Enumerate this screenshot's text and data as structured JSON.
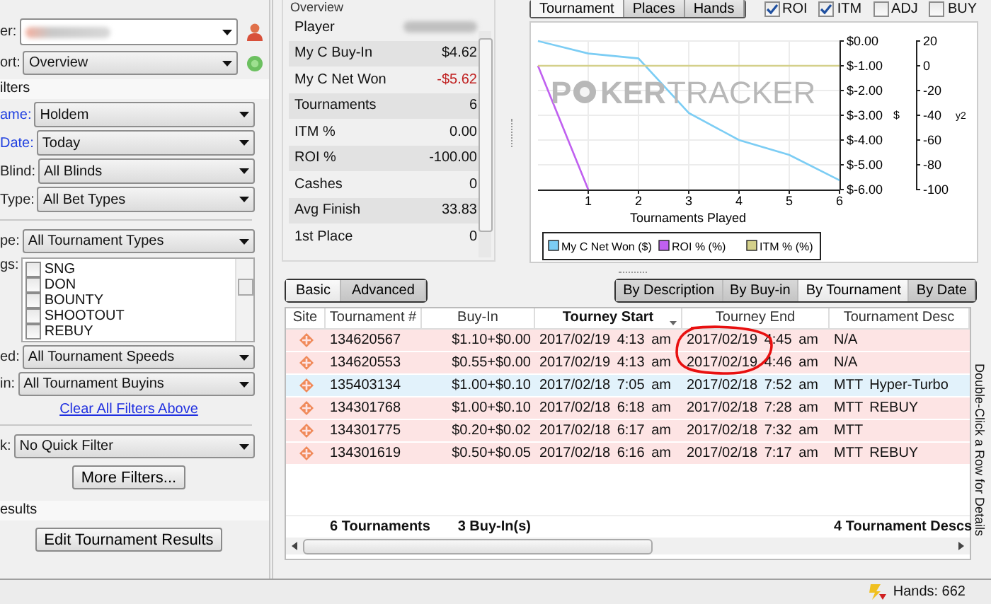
{
  "left_panel": {
    "player": {
      "label": "er:"
    },
    "report": {
      "label": "ort:",
      "value": "Overview"
    },
    "filters_title": "ilters",
    "filters": [
      {
        "label": "ame:",
        "value": "Holdem",
        "highlighted": true
      },
      {
        "label": "Date:",
        "value": "Today",
        "highlighted": true
      },
      {
        "label": "Blind:",
        "value": "All Blinds",
        "highlighted": false
      },
      {
        "label": "Type:",
        "value": "All Bet Types",
        "highlighted": false
      }
    ],
    "tournament_type": {
      "label": "pe:",
      "value": "All Tournament Types"
    },
    "flags": {
      "label": "gs:",
      "items": [
        {
          "label": "SNG",
          "checked": false
        },
        {
          "label": "DON",
          "checked": false
        },
        {
          "label": "BOUNTY",
          "checked": false
        },
        {
          "label": "SHOOTOUT",
          "checked": false
        },
        {
          "label": "REBUY",
          "checked": false
        }
      ]
    },
    "speed": {
      "label": "ed:",
      "value": "All Tournament Speeds"
    },
    "buyin": {
      "label": "in:",
      "value": "All Tournament Buyins"
    },
    "clear_link": "Clear All Filters Above",
    "quick_filter": {
      "label": "k:",
      "value": "No Quick Filter"
    },
    "more_filters_button": "More Filters...",
    "results_title": "esults",
    "edit_results_button": "Edit Tournament Results"
  },
  "overview": {
    "title": "Overview",
    "rows": [
      {
        "label": "Player",
        "value": "",
        "redacted": true,
        "negative": false
      },
      {
        "label": "My C Buy-In",
        "value": "$4.62",
        "redacted": false,
        "negative": false
      },
      {
        "label": "My C Net Won",
        "value": "-$5.62",
        "redacted": false,
        "negative": true
      },
      {
        "label": "Tournaments",
        "value": "6",
        "redacted": false,
        "negative": false
      },
      {
        "label": "ITM %",
        "value": "0.00",
        "redacted": false,
        "negative": false
      },
      {
        "label": "ROI %",
        "value": "-100.00",
        "redacted": false,
        "negative": false
      },
      {
        "label": "Cashes",
        "value": "0",
        "redacted": false,
        "negative": false
      },
      {
        "label": "Avg Finish",
        "value": "33.83",
        "redacted": false,
        "negative": false
      },
      {
        "label": "1st Place",
        "value": "0",
        "redacted": false,
        "negative": false
      }
    ]
  },
  "graph": {
    "tabs": [
      {
        "label": "Tournament",
        "selected": true
      },
      {
        "label": "Places",
        "selected": false
      },
      {
        "label": "Hands",
        "selected": false
      }
    ],
    "toggles": [
      {
        "label": "ROI",
        "checked": true
      },
      {
        "label": "ITM",
        "checked": true
      },
      {
        "label": "ADJ",
        "checked": false
      },
      {
        "label": "BUY",
        "checked": false
      }
    ],
    "watermark": {
      "lead": "P",
      "bold": "KER",
      "light": "TRACKER"
    },
    "chart_data": {
      "type": "line",
      "xlabel": "Tournaments Played",
      "ylabel": "$",
      "y2label": "y2",
      "x": [
        0,
        1,
        2,
        3,
        4,
        5,
        6
      ],
      "series": [
        {
          "name": "My C Net Won ($)",
          "color": "#7ccdf4",
          "axis": "y",
          "values": [
            0,
            -0.5,
            -0.7,
            -2.9,
            -4.0,
            -4.6,
            -5.62
          ]
        },
        {
          "name": "ROI % (%)",
          "color": "#c060f0",
          "axis": "y2",
          "values": [
            0,
            -100,
            null,
            null,
            null,
            null,
            null
          ]
        },
        {
          "name": "ITM % (%)",
          "color": "#d4d08a",
          "axis": "y2",
          "values": [
            0,
            0,
            0,
            0,
            0,
            0,
            0
          ]
        }
      ],
      "grid": true,
      "legend": "bottom-left",
      "xlim": [
        0,
        6
      ],
      "ylim": [
        -6,
        0
      ],
      "y2lim": [
        -100,
        20
      ],
      "xticks": [
        1,
        2,
        3,
        4,
        5,
        6
      ],
      "yticks": [
        {
          "value": 0,
          "label": "$0.00"
        },
        {
          "value": -1,
          "label": "$-1.00"
        },
        {
          "value": -2,
          "label": "$-2.00"
        },
        {
          "value": -3,
          "label": "$-3.00"
        },
        {
          "value": -4,
          "label": "$-4.00"
        },
        {
          "value": -5,
          "label": "$-5.00"
        },
        {
          "value": -6,
          "label": "$-6.00"
        }
      ],
      "y2ticks": [
        20,
        0,
        -20,
        -40,
        -60,
        -80,
        -100
      ]
    }
  },
  "results": {
    "view_buttons": [
      {
        "label": "Basic",
        "selected": true
      },
      {
        "label": "Advanced",
        "selected": false
      }
    ],
    "group_buttons": [
      {
        "label": "By Description",
        "selected": false
      },
      {
        "label": "By Buy-in",
        "selected": false
      },
      {
        "label": "By Tournament",
        "selected": true
      },
      {
        "label": "By Date",
        "selected": false
      }
    ],
    "site_column": "Site",
    "columns": [
      {
        "label": "Tournament #",
        "sorted": false
      },
      {
        "label": "Buy-In",
        "sorted": false
      },
      {
        "label": "Tourney Start",
        "sorted": true
      },
      {
        "label": "Tourney End",
        "sorted": false
      },
      {
        "label": "Tournament Desc",
        "sorted": false
      }
    ],
    "rows": [
      {
        "selected": false,
        "cells": [
          "134620567",
          "$1.10+$0.00",
          "2017/02/19 4:13 am",
          "2017/02/19 4:45 am",
          "N/A"
        ]
      },
      {
        "selected": false,
        "cells": [
          "134620553",
          "$0.55+$0.00",
          "2017/02/19 4:13 am",
          "2017/02/19 4:46 am",
          "N/A"
        ]
      },
      {
        "selected": true,
        "cells": [
          "135403134",
          "$1.00+$0.10",
          "2017/02/18 7:05 am",
          "2017/02/18 7:52 am",
          "MTT Hyper-Turbo"
        ]
      },
      {
        "selected": false,
        "cells": [
          "134301768",
          "$1.00+$0.10",
          "2017/02/18 6:18 am",
          "2017/02/18 7:28 am",
          "MTT REBUY"
        ]
      },
      {
        "selected": false,
        "cells": [
          "134301775",
          "$0.20+$0.02",
          "2017/02/18 6:17 am",
          "2017/02/18 7:32 am",
          "MTT"
        ]
      },
      {
        "selected": false,
        "cells": [
          "134301619",
          "$0.50+$0.05",
          "2017/02/18 6:16 am",
          "2017/02/18 7:17 am",
          "MTT REBUY"
        ]
      }
    ],
    "totals": {
      "tournaments": "6 Tournaments",
      "buy_ins": "3 Buy-In(s)",
      "descriptions": "4 Tournament Descs"
    },
    "hint": "Double-Click a Row for Details"
  },
  "status_bar": {
    "hands": "Hands: 662"
  }
}
